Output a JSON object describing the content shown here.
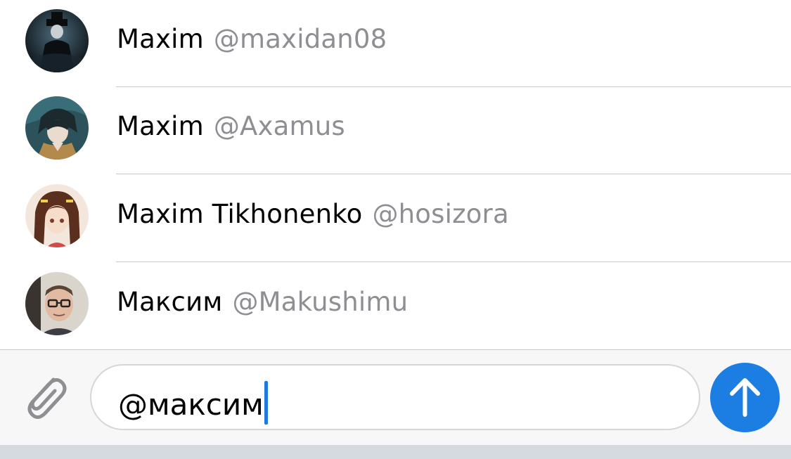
{
  "mentions": [
    {
      "name": "Maxim",
      "username": "@maxidan08",
      "avatar_color": "#1f2a33"
    },
    {
      "name": "Maxim",
      "username": "@Axamus",
      "avatar_color": "#2f5660"
    },
    {
      "name": "Maxim Tikhonenko",
      "username": "@hosizora",
      "avatar_color": "#e8c9b5"
    },
    {
      "name": "Максим",
      "username": "@Makushimu",
      "avatar_color": "#6f5d52"
    }
  ],
  "composer": {
    "text": "@максим"
  },
  "icons": {
    "attach": "paperclip-icon",
    "send": "arrow-up-icon"
  },
  "colors": {
    "accent": "#1c7ee3",
    "username": "#8e8e93"
  }
}
